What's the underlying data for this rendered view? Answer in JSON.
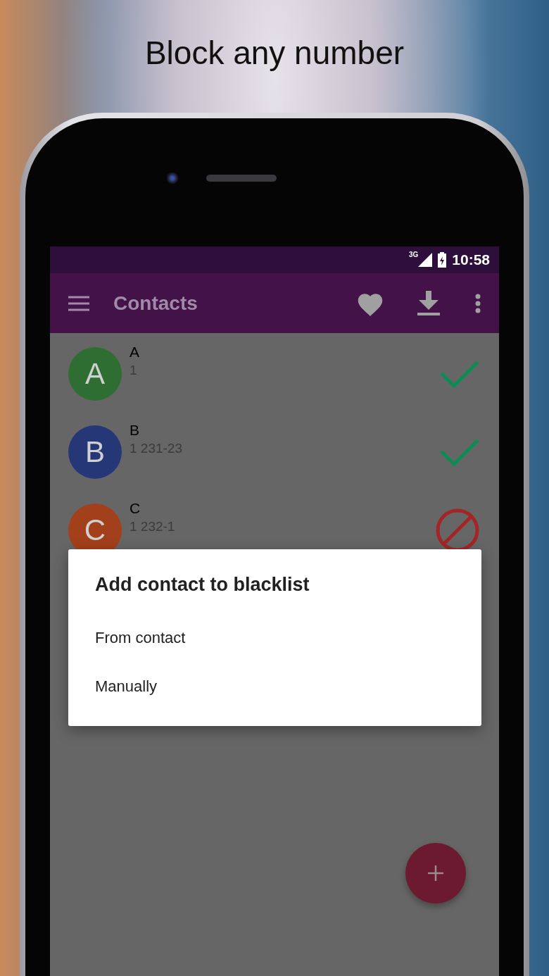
{
  "headline": "Block any number",
  "status_bar": {
    "network": "3G",
    "time": "10:58"
  },
  "toolbar": {
    "title": "Contacts"
  },
  "contacts": [
    {
      "initial": "A",
      "name": "A",
      "number": "1",
      "color": "#2e6e33",
      "kind": "allowed"
    },
    {
      "initial": "B",
      "name": "B",
      "number": "1 231-23",
      "color": "#263777",
      "kind": "allowed"
    },
    {
      "initial": "C",
      "name": "C",
      "number": "1 232-1",
      "color": "#a3401c",
      "kind": "blocked"
    }
  ],
  "dialog": {
    "title": "Add contact to blacklist",
    "options": [
      "From contact",
      "Manually"
    ]
  }
}
